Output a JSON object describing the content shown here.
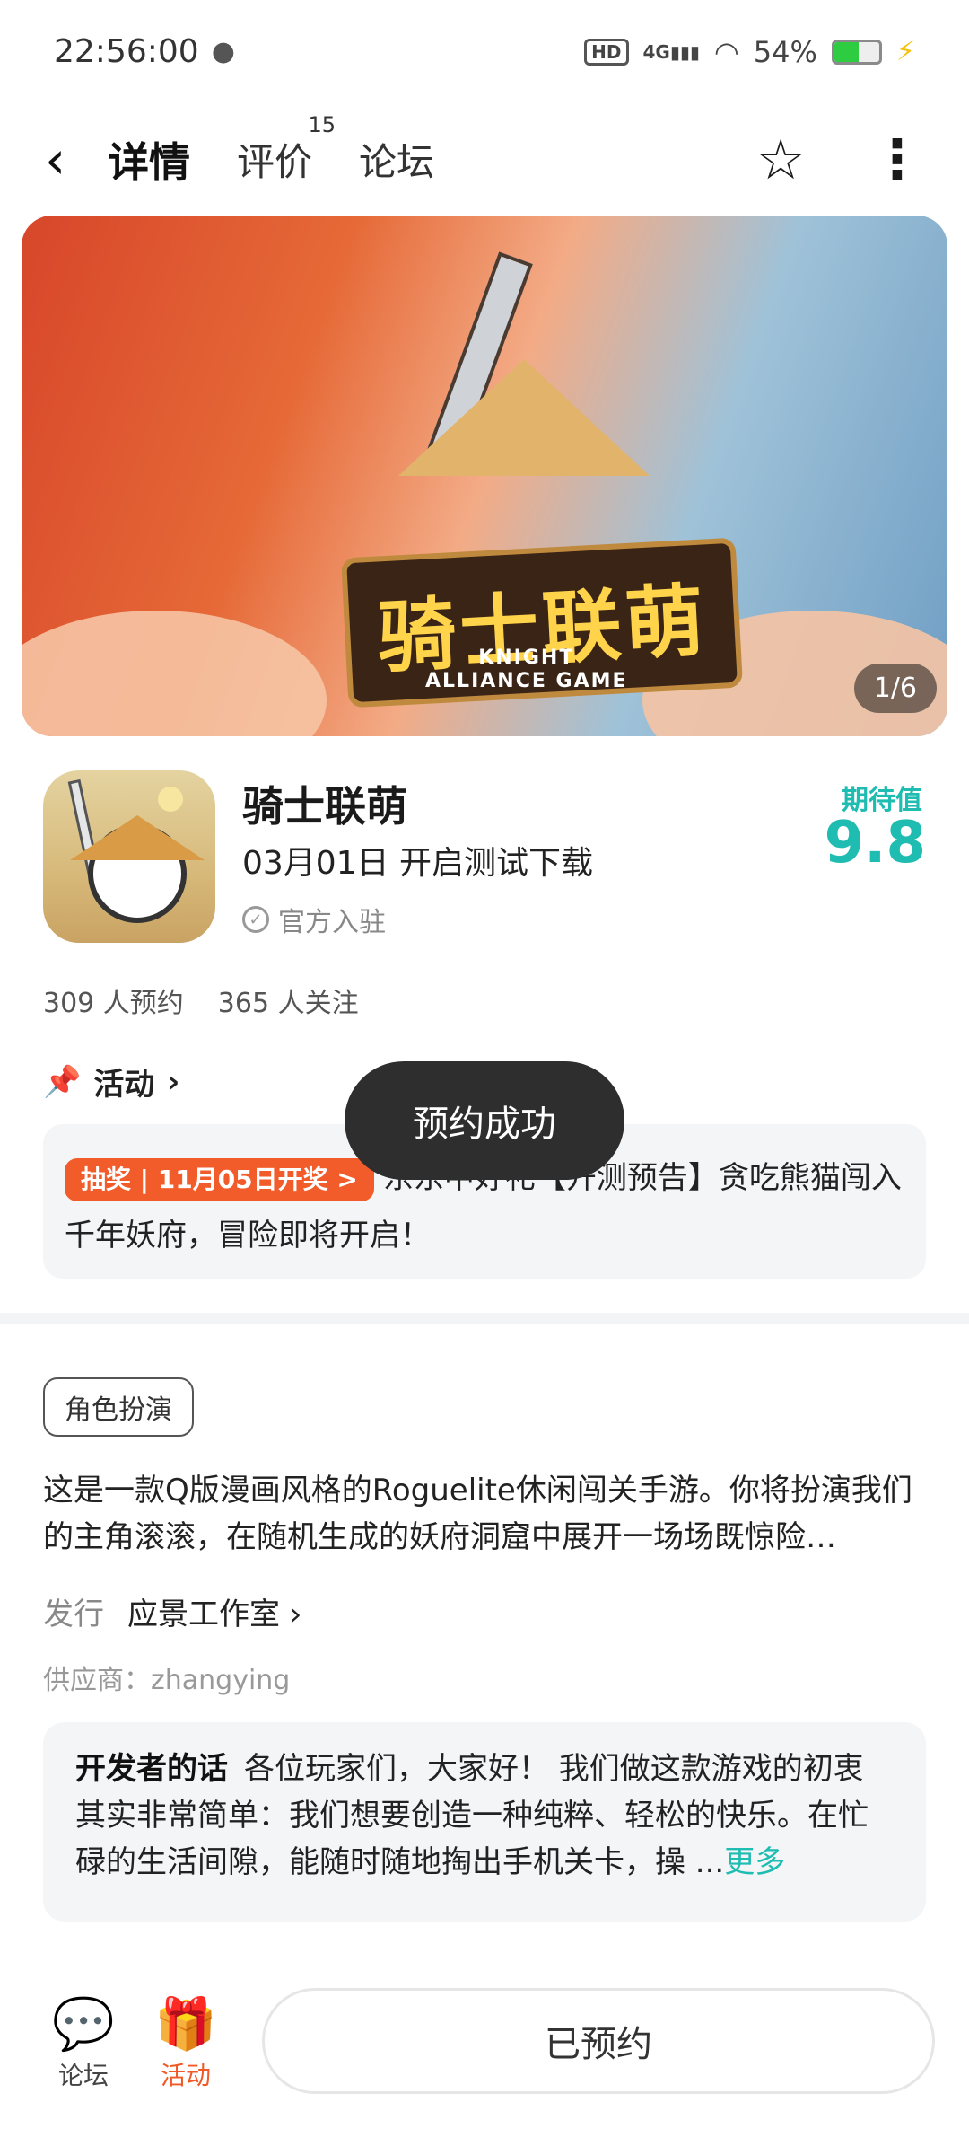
{
  "status_bar": {
    "time": "22:56:00",
    "wechat_icon": "wechat-icon",
    "hd": "HD",
    "network": "4G",
    "battery_text": "54%",
    "battery_level": 0.54
  },
  "nav": {
    "tabs": [
      {
        "label": "详情",
        "active": true
      },
      {
        "label": "评价",
        "badge": "15"
      },
      {
        "label": "论坛"
      }
    ]
  },
  "banner": {
    "title": "骑士联萌",
    "subtitle_line1": "KNIGHT",
    "subtitle_line2": "ALLIANCE GAME",
    "counter": "1/6"
  },
  "app": {
    "name": "骑士联萌",
    "date_text": "03月01日 开启测试下载",
    "official": "官方入驻",
    "expect_label": "期待值",
    "expect_value": "9.8"
  },
  "stats": {
    "reserve": "309 人预约",
    "follow": "365 人关注"
  },
  "activity": {
    "title": "活动",
    "tag": "抽奖 | 11月05日开奖 >",
    "text": "东东中好礼【开测预告】贪吃熊猫闯入千年妖府，冒险即将开启！"
  },
  "toast": "预约成功",
  "genre": "角色扮演",
  "description": "这是一款Q版漫画风格的Roguelite休闲闯关手游。你将扮演我们的主角滚滚，在随机生成的妖府洞窟中展开一场场既惊险…",
  "publisher": {
    "label": "发行",
    "value": "应景工作室"
  },
  "supplier": "供应商：zhangying",
  "developer": {
    "label": "开发者的话",
    "text": "各位玩家们，大家好！ 我们做这款游戏的初衷其实非常简单：我们想要创造一种纯粹、轻松的快乐。在忙碌的生活间隙，能随时随地掏出手机关卡，操 ...",
    "more": "更多"
  },
  "bottom": {
    "forum": "论坛",
    "activity": "活动",
    "reserved": "已预约"
  },
  "colors": {
    "accent": "#1fbcb2",
    "orange": "#f05a28"
  }
}
